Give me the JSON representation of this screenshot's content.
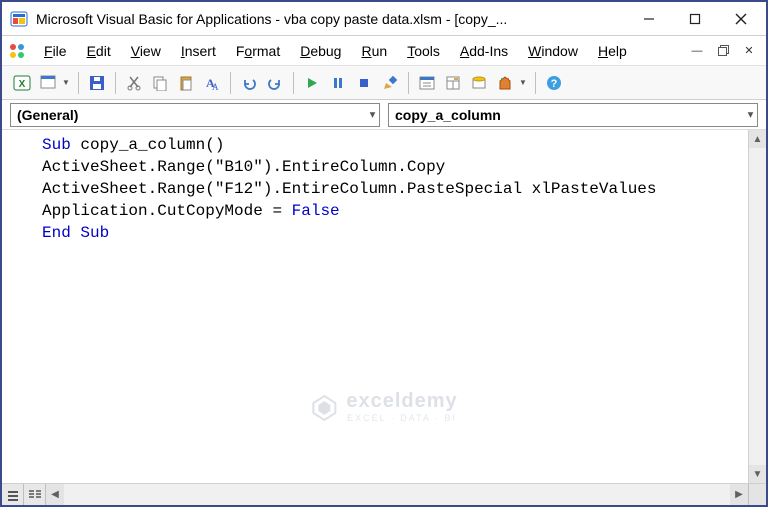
{
  "titlebar": {
    "title": "Microsoft Visual Basic for Applications - vba copy paste data.xlsm - [copy_..."
  },
  "menu": {
    "items": [
      "File",
      "Edit",
      "View",
      "Insert",
      "Format",
      "Debug",
      "Run",
      "Tools",
      "Add-Ins",
      "Window",
      "Help"
    ]
  },
  "dropdowns": {
    "object": "(General)",
    "procedure": "copy_a_column"
  },
  "code": {
    "lines": [
      {
        "t": "kw_bw",
        "pre": "Sub",
        "rest": " copy_a_column()"
      },
      {
        "t": "plain",
        "text": "ActiveSheet.Range(\"B10\").EntireColumn.Copy"
      },
      {
        "t": "plain",
        "text": "ActiveSheet.Range(\"F12\").EntireColumn.PasteSpecial xlPasteValues"
      },
      {
        "t": "assign",
        "lhs": "Application.CutCopyMode = ",
        "rhs": "False"
      },
      {
        "t": "kw",
        "text": "End Sub"
      }
    ]
  },
  "watermark": {
    "brand": "exceldemy",
    "tag": "EXCEL · DATA · BI"
  },
  "icons": {
    "app": "vba",
    "toolbar_names": [
      "view-excel",
      "insert-form",
      "save",
      "cut",
      "copy",
      "paste",
      "find",
      "undo",
      "redo",
      "run",
      "break",
      "reset",
      "design-mode",
      "project-explorer",
      "properties-window",
      "object-browser",
      "toolbox",
      "references",
      "help"
    ]
  }
}
